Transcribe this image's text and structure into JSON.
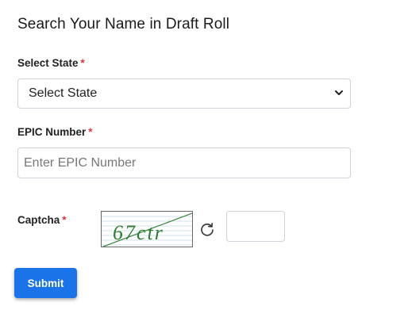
{
  "page": {
    "title": "Search Your Name in Draft Roll"
  },
  "form": {
    "state": {
      "label": "Select State",
      "required_mark": "*",
      "selected": "Select State"
    },
    "epic": {
      "label": "EPIC Number",
      "required_mark": "*",
      "placeholder": "Enter EPIC Number",
      "value": ""
    },
    "captcha": {
      "label": "Captcha",
      "required_mark": "*",
      "image_text": "67ctr",
      "input_value": ""
    },
    "submit_label": "Submit"
  },
  "colors": {
    "primary": "#1a73e8",
    "required": "#dc3545",
    "captcha_text": "#2e7d32"
  },
  "icons": {
    "refresh": "refresh-icon",
    "dropdown": "chevron-down-icon"
  }
}
